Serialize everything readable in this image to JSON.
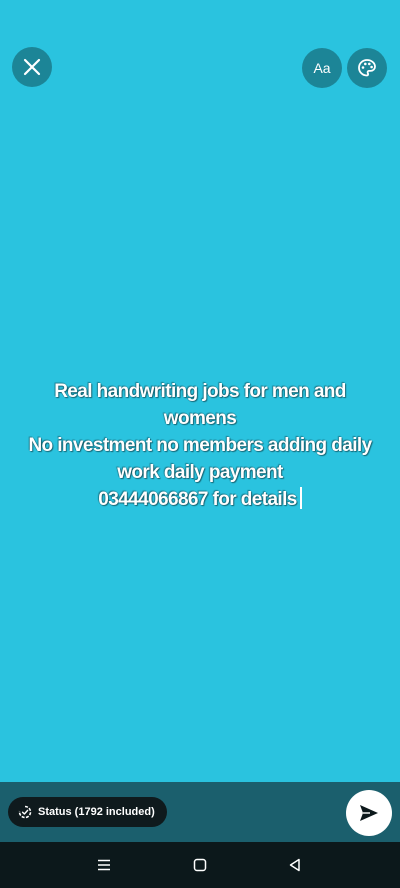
{
  "editor": {
    "font_button_label": "Aa",
    "text_lines": [
      "Real handwriting jobs for men and",
      "womens",
      "No investment no members adding daily",
      "work daily payment",
      "03444066867 for details"
    ],
    "background_color": "#2ac3df"
  },
  "toolbar": {
    "close_icon": "close-icon",
    "font_icon": "font-icon",
    "palette_icon": "palette-icon"
  },
  "footer": {
    "status_chip_label": "Status (1792 included)",
    "status_icon": "status-ring-icon",
    "send_icon": "send-icon"
  },
  "navigation": {
    "menu_icon": "menu-icon",
    "home_icon": "home-icon",
    "back_icon": "back-icon"
  }
}
